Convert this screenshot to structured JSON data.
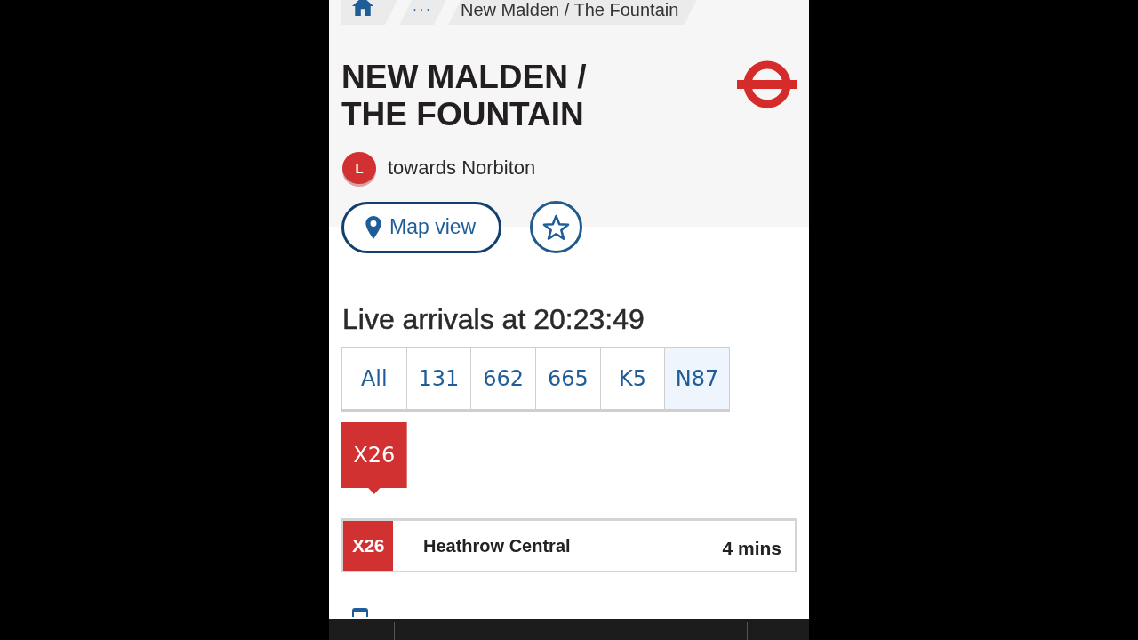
{
  "breadcrumb": [
    {
      "kind": "home"
    },
    {
      "kind": "link",
      "label": "..."
    },
    {
      "kind": "link",
      "label": "New Malden / The Fountain"
    }
  ],
  "stop": {
    "name": "NEW MALDEN / THE FOUNTAIN",
    "letter": "L",
    "direction": "towards Norbiton"
  },
  "actions": {
    "map_button": "Map view",
    "favourite": {
      "checked": false
    }
  },
  "arrivals": {
    "heading": "Live arrivals at 20:23:49",
    "route_tabs": [
      {
        "label": "All",
        "selected": false,
        "hovered": false
      },
      {
        "label": "131",
        "selected": false,
        "hovered": false
      },
      {
        "label": "662",
        "selected": false,
        "hovered": false
      },
      {
        "label": "665",
        "selected": false,
        "hovered": false
      },
      {
        "label": "K5",
        "selected": false,
        "hovered": false
      },
      {
        "label": "N87",
        "selected": false,
        "hovered": true
      },
      {
        "label": "X26",
        "selected": true,
        "hovered": false
      }
    ],
    "rows": [
      {
        "route": "X26",
        "destination": "Heathrow Central",
        "due": "4 mins"
      }
    ]
  }
}
